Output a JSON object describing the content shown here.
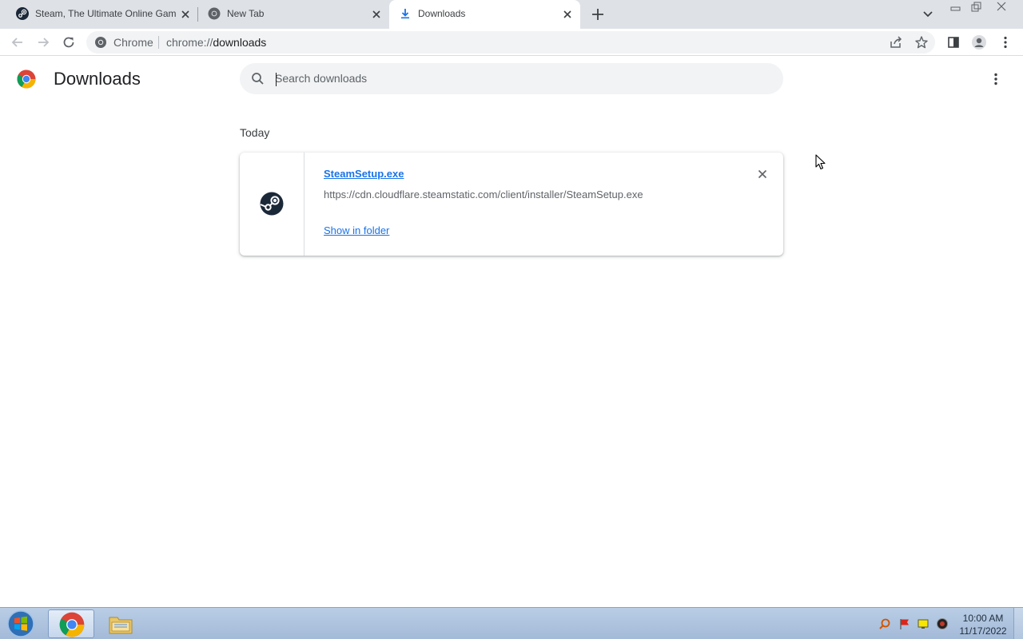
{
  "tabs": [
    {
      "title": "Steam, The Ultimate Online Gam",
      "favicon": "steam-icon",
      "active": false
    },
    {
      "title": "New Tab",
      "favicon": "chrome-icon",
      "active": false
    },
    {
      "title": "Downloads",
      "favicon": "download-icon",
      "active": true
    }
  ],
  "toolbar": {
    "site_chip": "Chrome",
    "url_scheme": "chrome://",
    "url_path": "downloads"
  },
  "page": {
    "title": "Downloads",
    "search_placeholder": "Search downloads",
    "section_date": "Today"
  },
  "downloads": [
    {
      "file_name": "SteamSetup.exe",
      "url": "https://cdn.cloudflare.steamstatic.com/client/installer/SteamSetup.exe",
      "action": "Show in folder",
      "icon": "steam-icon"
    }
  ],
  "taskbar": {
    "time": "10:00 AM",
    "date": "11/17/2022"
  },
  "colors": {
    "accent": "#1a73e8",
    "tabstrip": "#dee1e6",
    "steam_blue": "#1b2838"
  }
}
